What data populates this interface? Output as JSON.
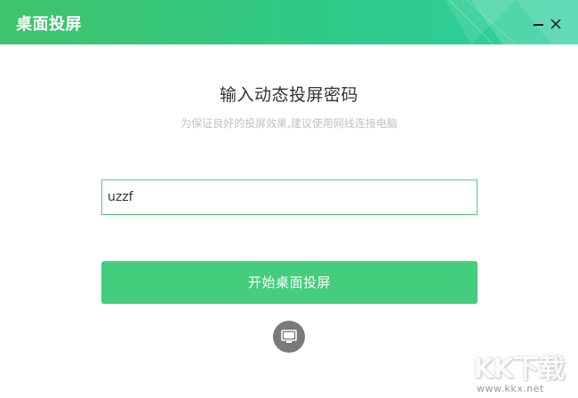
{
  "window": {
    "title": "桌面投屏"
  },
  "main": {
    "heading": "输入动态投屏密码",
    "subheading": "为保证良好的投屏效果,建议使用网线连接电脑",
    "password_value": "uzzf",
    "start_label": "开始桌面投屏"
  },
  "icons": {
    "minimize": "minimize-icon",
    "close": "close-icon",
    "monitor": "monitor-icon"
  },
  "watermark": {
    "logo": "KK下载",
    "url": "www.kkx.net"
  },
  "colors": {
    "titlebar_start": "#3fc46b",
    "titlebar_end": "#2fcfa0",
    "accent": "#43cd7c",
    "input_border": "#52c97f"
  }
}
